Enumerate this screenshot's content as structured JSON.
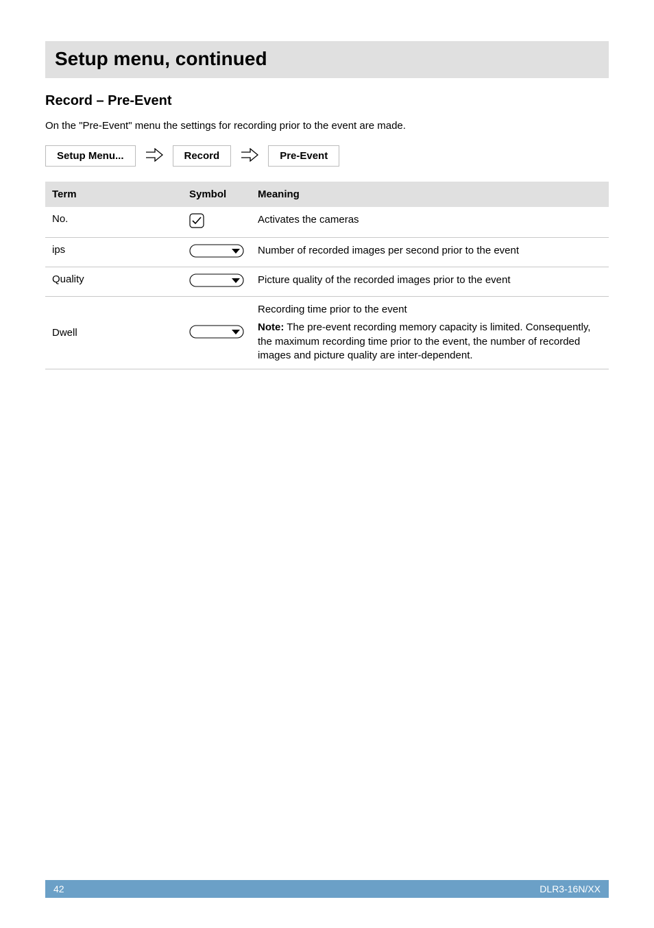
{
  "title": "Setup menu, continued",
  "section_heading": "Record – Pre-Event",
  "intro": "On the \"Pre-Event\" menu the settings for recording prior to the event are made.",
  "breadcrumb": {
    "item1": "Setup Menu...",
    "item2": "Record",
    "item3": "Pre-Event"
  },
  "table": {
    "headers": {
      "term": "Term",
      "symbol": "Symbol",
      "meaning": "Meaning"
    },
    "rows": [
      {
        "term": "No.",
        "symbol_type": "check",
        "meaning": "Activates the cameras"
      },
      {
        "term": "ips",
        "symbol_type": "dropdown",
        "meaning": "Number of recorded images per second prior to the event"
      },
      {
        "term": "Quality",
        "symbol_type": "dropdown",
        "meaning": "Picture quality of the recorded images prior to the event"
      },
      {
        "term": "Dwell",
        "symbol_type": "dropdown",
        "meaning_line1": "Recording time prior to the event",
        "note_label": "Note:",
        "note_text": " The pre-event recording memory capacity is limited. Consequently, the maximum recording time prior to the event, the number of recorded images and picture quality are inter-dependent."
      }
    ]
  },
  "footer": {
    "page_number": "42",
    "doc_id": "DLR3-16N/XX"
  }
}
